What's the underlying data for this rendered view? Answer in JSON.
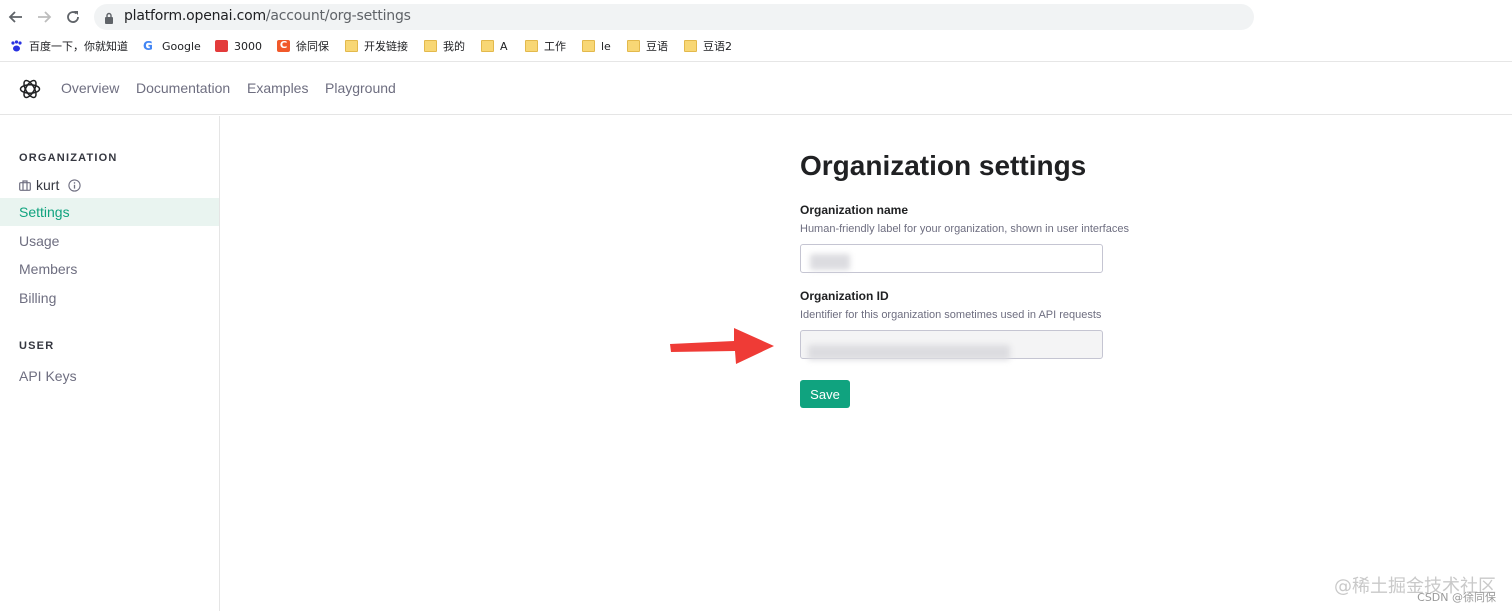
{
  "browser": {
    "url_host": "platform.openai.com",
    "url_path": "/account/org-settings",
    "bookmarks": [
      "百度一下，你就知道",
      "Google",
      "3000",
      "徐同保",
      "开发链接",
      "我的",
      "A",
      "工作",
      "le",
      "豆语",
      "豆语2"
    ]
  },
  "header": {
    "nav": [
      "Overview",
      "Documentation",
      "Examples",
      "Playground"
    ]
  },
  "sidebar": {
    "org_section": "ORGANIZATION",
    "org_name": "kurt",
    "items": [
      "Settings",
      "Usage",
      "Members",
      "Billing"
    ],
    "user_section": "USER",
    "user_items": [
      "API Keys"
    ]
  },
  "main": {
    "title": "Organization settings",
    "name_label": "Organization name",
    "name_help": "Human-friendly label for your organization, shown in user interfaces",
    "id_label": "Organization ID",
    "id_help": "Identifier for this organization sometimes used in API requests",
    "save_label": "Save"
  },
  "watermark": {
    "line1": "@稀土掘金技术社区",
    "line2": "CSDN @徐同保"
  },
  "colors": {
    "accent": "#10a37f",
    "active_bg": "#e9f4f0",
    "arrow": "#ef3b36"
  }
}
